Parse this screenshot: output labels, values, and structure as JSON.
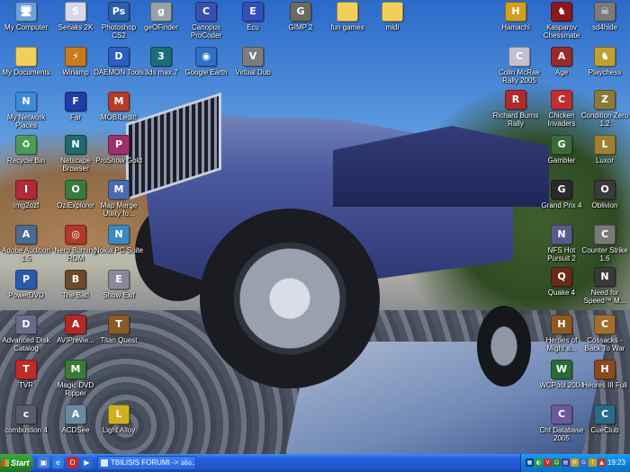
{
  "desktop": {
    "icons_left": [
      {
        "label": "My Computer",
        "icon": "my-computer-icon",
        "glyph": "🖥",
        "color": "#6f9fd8"
      },
      {
        "label": "Seriaks 2K",
        "icon": "serials-icon",
        "glyph": "S",
        "color": "#d8d8e8"
      },
      {
        "label": "Photoshop CS2",
        "icon": "photoshop-icon",
        "glyph": "Ps",
        "color": "#2b5fa8"
      },
      {
        "label": "geOFinder",
        "icon": "geofinder-icon",
        "glyph": "g",
        "color": "#9aa0a8"
      },
      {
        "label": "Canopus ProCoder",
        "icon": "procoder-icon",
        "glyph": "C",
        "color": "#3a4fb0"
      },
      {
        "label": "Ecu",
        "icon": "ecu-icon",
        "glyph": "E",
        "color": "#3450b8"
      },
      {
        "label": "GIMP 2",
        "icon": "gimp-icon",
        "glyph": "G",
        "color": "#6a6a60"
      },
      {
        "label": "fun games",
        "icon": "folder-icon",
        "glyph": "",
        "color": "#f2cf5a"
      },
      {
        "label": "midi",
        "icon": "folder-icon",
        "glyph": "",
        "color": "#f2cf5a"
      },
      {
        "label": "My Documents",
        "icon": "my-documents-icon",
        "glyph": "",
        "color": "#f2cf5a"
      },
      {
        "label": "Winamp",
        "icon": "winamp-icon",
        "glyph": "⚡",
        "color": "#c97a1a"
      },
      {
        "label": "DAEMON Tools",
        "icon": "daemon-tools-icon",
        "glyph": "D",
        "color": "#2d5fbe"
      },
      {
        "label": "3ds max 7",
        "icon": "3ds-max-icon",
        "glyph": "3",
        "color": "#1d6c7a"
      },
      {
        "label": "Google Earth",
        "icon": "google-earth-icon",
        "glyph": "◉",
        "color": "#2f6fc6"
      },
      {
        "label": "Virtual Dub",
        "icon": "virtualdub-icon",
        "glyph": "V",
        "color": "#7c7c7c"
      },
      {
        "label": "My Network Places",
        "icon": "network-places-icon",
        "glyph": "N",
        "color": "#3d8ad6"
      },
      {
        "label": "Far",
        "icon": "far-manager-icon",
        "glyph": "F",
        "color": "#1f3ea8"
      },
      {
        "label": "MOBILedit!",
        "icon": "mobiledit-icon",
        "glyph": "M",
        "color": "#b83a2a"
      },
      {
        "label": "Recycle Bin",
        "icon": "recycle-bin-icon",
        "glyph": "♻",
        "color": "#4a9a58"
      },
      {
        "label": "Netscape Browser",
        "icon": "netscape-icon",
        "glyph": "N",
        "color": "#1e6a70"
      },
      {
        "label": "ProShow Gold",
        "icon": "proshow-icon",
        "glyph": "P",
        "color": "#a0306a"
      },
      {
        "label": "Img2ozf",
        "icon": "img2ozf-icon",
        "glyph": "I",
        "color": "#b02a3a"
      },
      {
        "label": "OziExplorer",
        "icon": "oziexplorer-icon",
        "glyph": "O",
        "color": "#3a7a3a"
      },
      {
        "label": "Map Merge Utility fo...",
        "icon": "map-merge-icon",
        "glyph": "M",
        "color": "#4a6ab0"
      },
      {
        "label": "Adobe Audition 1.5",
        "icon": "audition-icon",
        "glyph": "A",
        "color": "#4d6a90"
      },
      {
        "label": "Nero Burning ROM",
        "icon": "nero-icon",
        "glyph": "◎",
        "color": "#b03a2a"
      },
      {
        "label": "Nokia PC Suite",
        "icon": "nokia-pc-suite-icon",
        "glyph": "N",
        "color": "#3a8ac0"
      },
      {
        "label": "PowerDVD",
        "icon": "powerdvd-icon",
        "glyph": "P",
        "color": "#2a5ab0"
      },
      {
        "label": "The Bat!",
        "icon": "the-bat-icon",
        "glyph": "B",
        "color": "#6a4a2a"
      },
      {
        "label": "Show Exif",
        "icon": "show-exif-icon",
        "glyph": "E",
        "color": "#8a8a9a"
      },
      {
        "label": "Advanced Disk Catalog",
        "icon": "disk-catalog-icon",
        "glyph": "D",
        "color": "#6a6a8a"
      },
      {
        "label": "AVIPrevie...",
        "icon": "avipreview-icon",
        "glyph": "A",
        "color": "#b02a2a"
      },
      {
        "label": "Titan Quest",
        "icon": "titan-quest-icon",
        "glyph": "T",
        "color": "#8a5a2a"
      },
      {
        "label": "TVR",
        "icon": "tvr-icon",
        "glyph": "T",
        "color": "#c02a2a"
      },
      {
        "label": "Magic DVD Ripper",
        "icon": "magic-dvd-ripper-icon",
        "glyph": "M",
        "color": "#3a7a3a"
      },
      {
        "label": "combustion 4",
        "icon": "combustion-icon",
        "glyph": "c",
        "color": "#5a5a6a"
      },
      {
        "label": "ACDSee",
        "icon": "acdsee-icon",
        "glyph": "A",
        "color": "#6a8aa0"
      },
      {
        "label": "Light Alloy",
        "icon": "light-alloy-icon",
        "glyph": "L",
        "color": "#d0b020"
      }
    ],
    "icons_right": [
      {
        "label": "Hamachi",
        "icon": "hamachi-icon",
        "glyph": "H",
        "color": "#d0a020"
      },
      {
        "label": "Kasparov Chessmate",
        "icon": "chessmate-icon",
        "glyph": "♞",
        "color": "#8a1a1a"
      },
      {
        "label": "sd4hide",
        "icon": "sd4hide-icon",
        "glyph": "☠",
        "color": "#7a7a7a"
      },
      {
        "label": "Colin McRae Rally 2005",
        "icon": "colin-mcrae-icon",
        "glyph": "C",
        "color": "#c0c0d0"
      },
      {
        "label": "Age",
        "icon": "age-icon",
        "glyph": "A",
        "color": "#9a2a2a"
      },
      {
        "label": "Playchess",
        "icon": "playchess-icon",
        "glyph": "♞",
        "color": "#c0a030"
      },
      {
        "label": "Richard Burns Rally",
        "icon": "richard-burns-icon",
        "glyph": "R",
        "color": "#b02a2a"
      },
      {
        "label": "Chicken Invaders",
        "icon": "chicken-invaders-icon",
        "glyph": "C",
        "color": "#c03030"
      },
      {
        "label": "Condition Zero 1.2",
        "icon": "condition-zero-icon",
        "glyph": "Z",
        "color": "#8a7a3a"
      },
      {
        "label": "Gambler",
        "icon": "gambler-icon",
        "glyph": "G",
        "color": "#3a6a3a"
      },
      {
        "label": "Luxor",
        "icon": "luxor-icon",
        "glyph": "L",
        "color": "#a08030"
      },
      {
        "label": "Grand Prix 4",
        "icon": "grand-prix-icon",
        "glyph": "G",
        "color": "#2a2a2a"
      },
      {
        "label": "Oblivion",
        "icon": "oblivion-icon",
        "glyph": "O",
        "color": "#3a3a3a"
      },
      {
        "label": "NFS Hot Pursuit 2",
        "icon": "nfs-hot-pursuit-icon",
        "glyph": "N",
        "color": "#5a5a8a"
      },
      {
        "label": "Counter Strike 1.6",
        "icon": "counter-strike-icon",
        "glyph": "C",
        "color": "#7a7a7a"
      },
      {
        "label": "Quake 4",
        "icon": "quake-icon",
        "glyph": "Q",
        "color": "#6a2a1a"
      },
      {
        "label": "Need for Speed™ M...",
        "icon": "need-for-speed-icon",
        "glyph": "N",
        "color": "#3a3a3a"
      },
      {
        "label": "Heroes of Might a...",
        "icon": "heroes-icon",
        "glyph": "H",
        "color": "#8a5a20"
      },
      {
        "label": "Cossacks - Back To War",
        "icon": "cossacks-icon",
        "glyph": "C",
        "color": "#a07030"
      },
      {
        "label": "WCPool 2004",
        "icon": "wcpool-icon",
        "glyph": "W",
        "color": "#2a6a3a"
      },
      {
        "label": "Heores III Full",
        "icon": "heroes-3-icon",
        "glyph": "H",
        "color": "#8a4a20"
      },
      {
        "label": "Cht Database 2005",
        "icon": "cht-database-icon",
        "glyph": "C",
        "color": "#6a5a9a"
      },
      {
        "label": "CueClub",
        "icon": "cueclub-icon",
        "glyph": "C",
        "color": "#2a6a8a"
      }
    ]
  },
  "taskbar": {
    "start_label": "Start",
    "quick_launch": [
      {
        "icon": "show-desktop-icon",
        "glyph": "▣",
        "color": "#4a7ad0"
      },
      {
        "icon": "internet-explorer-icon",
        "glyph": "e",
        "color": "#2a80e0"
      },
      {
        "icon": "opera-icon",
        "glyph": "O",
        "color": "#c02a2a"
      },
      {
        "icon": "media-player-icon",
        "glyph": "▶",
        "color": "#2a6ad0"
      }
    ],
    "window_button": "TBILISIS FORUMI -> აბა...",
    "tray_icons": [
      {
        "icon": "network-tray-icon",
        "glyph": "▦",
        "color": "#0a3a7a"
      },
      {
        "icon": "volume-tray-icon",
        "glyph": "◐",
        "color": "#2a9a3a"
      },
      {
        "icon": "antivirus-tray-icon",
        "glyph": "V",
        "color": "#c02a2a"
      },
      {
        "icon": "messenger-tray-icon",
        "glyph": "☺",
        "color": "#2a7a2a"
      },
      {
        "icon": "display-tray-icon",
        "glyph": "▤",
        "color": "#3a3a9a"
      },
      {
        "icon": "hamachi-tray-icon",
        "glyph": "H",
        "color": "#d09a20"
      },
      {
        "icon": "language-tray-icon",
        "glyph": "G",
        "color": "#3a6ac0"
      },
      {
        "icon": "update-tray-icon",
        "glyph": "!",
        "color": "#c0a020"
      },
      {
        "icon": "security-tray-icon",
        "glyph": "▲",
        "color": "#b03a2a"
      }
    ],
    "clock": "19:23"
  }
}
